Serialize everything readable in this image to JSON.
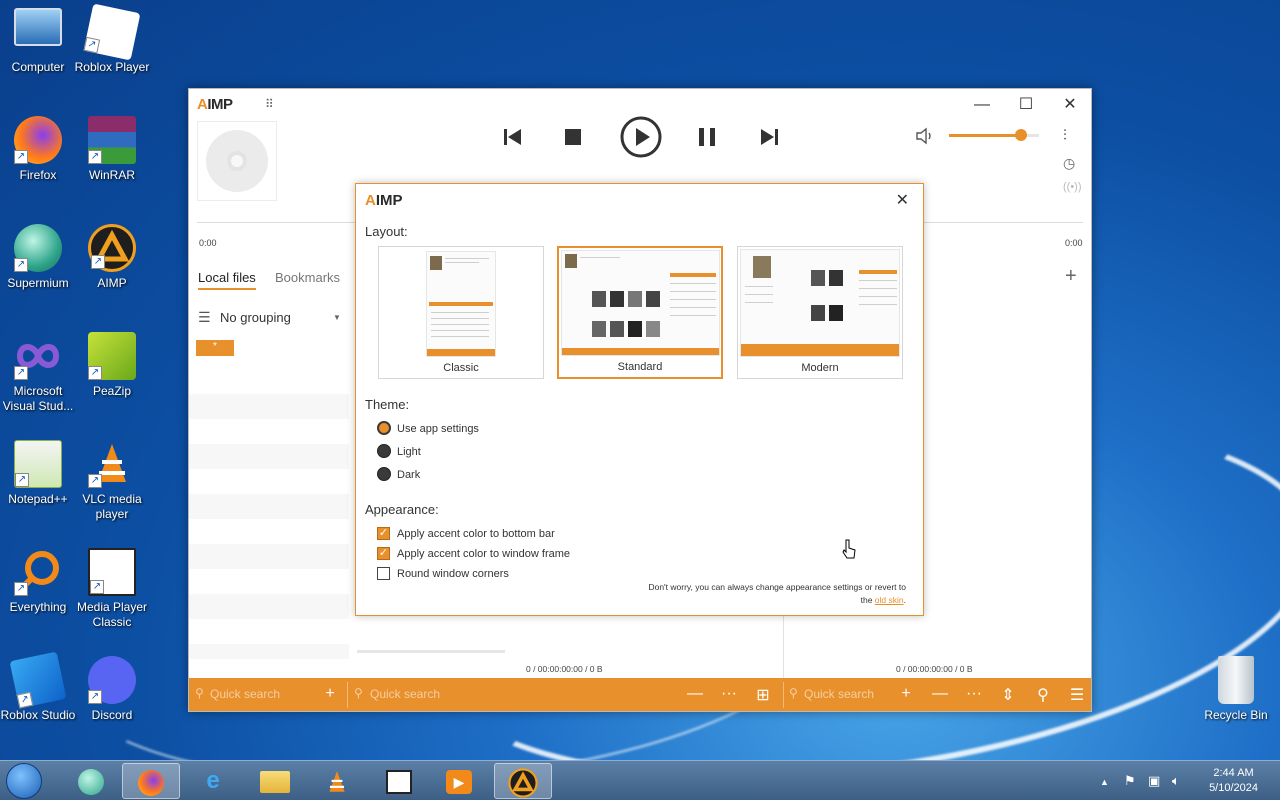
{
  "desktop": {
    "icons": [
      {
        "label": "Computer"
      },
      {
        "label": "Roblox Player"
      },
      {
        "label": "Firefox"
      },
      {
        "label": "WinRAR"
      },
      {
        "label": "Supermium"
      },
      {
        "label": "AIMP"
      },
      {
        "label": "Microsoft Visual Stud..."
      },
      {
        "label": "PeaZip"
      },
      {
        "label": "Notepad++"
      },
      {
        "label": "VLC media player"
      },
      {
        "label": "Everything"
      },
      {
        "label": "Media Player Classic"
      },
      {
        "label": "Roblox Studio"
      },
      {
        "label": "Discord"
      },
      {
        "label": "Recycle Bin"
      }
    ]
  },
  "aimp": {
    "logo_a": "A",
    "logo_rest": "IMP",
    "time_start": "0:00",
    "time_end": "0:00",
    "volume_level": 0.8,
    "tabs": [
      "Local files",
      "Bookmarks"
    ],
    "grouping": "No grouping",
    "group_tag": "*",
    "status_left": "0 / 00:00:00:00 / 0 B",
    "status_right": "0 / 00:00:00:00 / 0 B",
    "quick_search": "Quick search"
  },
  "dialog": {
    "logo_a": "A",
    "logo_rest": "IMP",
    "layout_heading": "Layout:",
    "layouts": [
      {
        "name": "Classic",
        "selected": false
      },
      {
        "name": "Standard",
        "selected": true
      },
      {
        "name": "Modern",
        "selected": false
      }
    ],
    "theme_heading": "Theme:",
    "themes": [
      {
        "label": "Use app settings",
        "selected": true
      },
      {
        "label": "Light",
        "selected": false
      },
      {
        "label": "Dark",
        "selected": false
      }
    ],
    "appearance_heading": "Appearance:",
    "appearance": [
      {
        "label": "Apply accent color to bottom bar",
        "checked": true
      },
      {
        "label": "Apply accent color to window frame",
        "checked": true
      },
      {
        "label": "Round window corners",
        "checked": false
      }
    ],
    "note_line1": "Don't worry, you can always change appearance settings or revert to",
    "note_line2_prefix": "the ",
    "note_link": "old skin",
    "note_suffix": "."
  },
  "taskbar": {
    "time": "2:44 AM",
    "date": "5/10/2024"
  },
  "colors": {
    "accent": "#e8902b"
  }
}
